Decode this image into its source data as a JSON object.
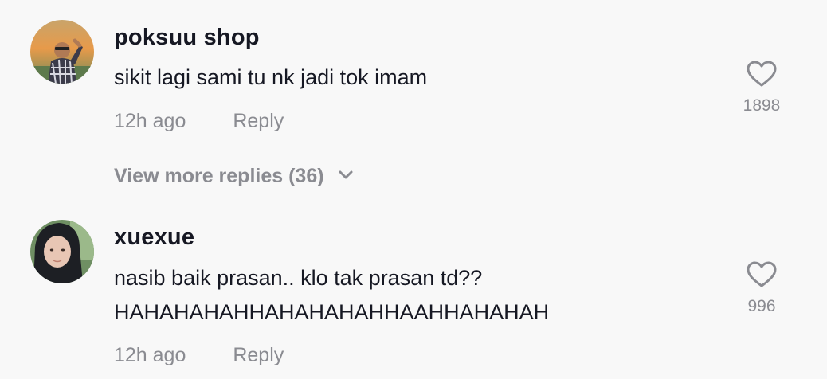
{
  "comments": [
    {
      "username": "poksuu shop",
      "text_lines": [
        "sikit lagi sami tu nk jadi tok imam"
      ],
      "time": "12h ago",
      "reply_label": "Reply",
      "likes": "1898",
      "avatar_icon": "user-photo-avatar"
    },
    {
      "username": "xuexue",
      "text_lines": [
        "nasib baik prasan.. klo tak prasan td??",
        "HAHAHAHAHHAHAHAHAHHAAHHAHAHAH"
      ],
      "time": "12h ago",
      "reply_label": "Reply",
      "likes": "996",
      "avatar_icon": "user-photo-avatar"
    }
  ],
  "view_more": {
    "label": "View more replies (36)",
    "icon": "chevron-down-icon"
  },
  "colors": {
    "background": "#f8f8f8",
    "primary_text": "#161823",
    "secondary_text": "#8a8b91",
    "heart_stroke": "#8a8b91"
  }
}
